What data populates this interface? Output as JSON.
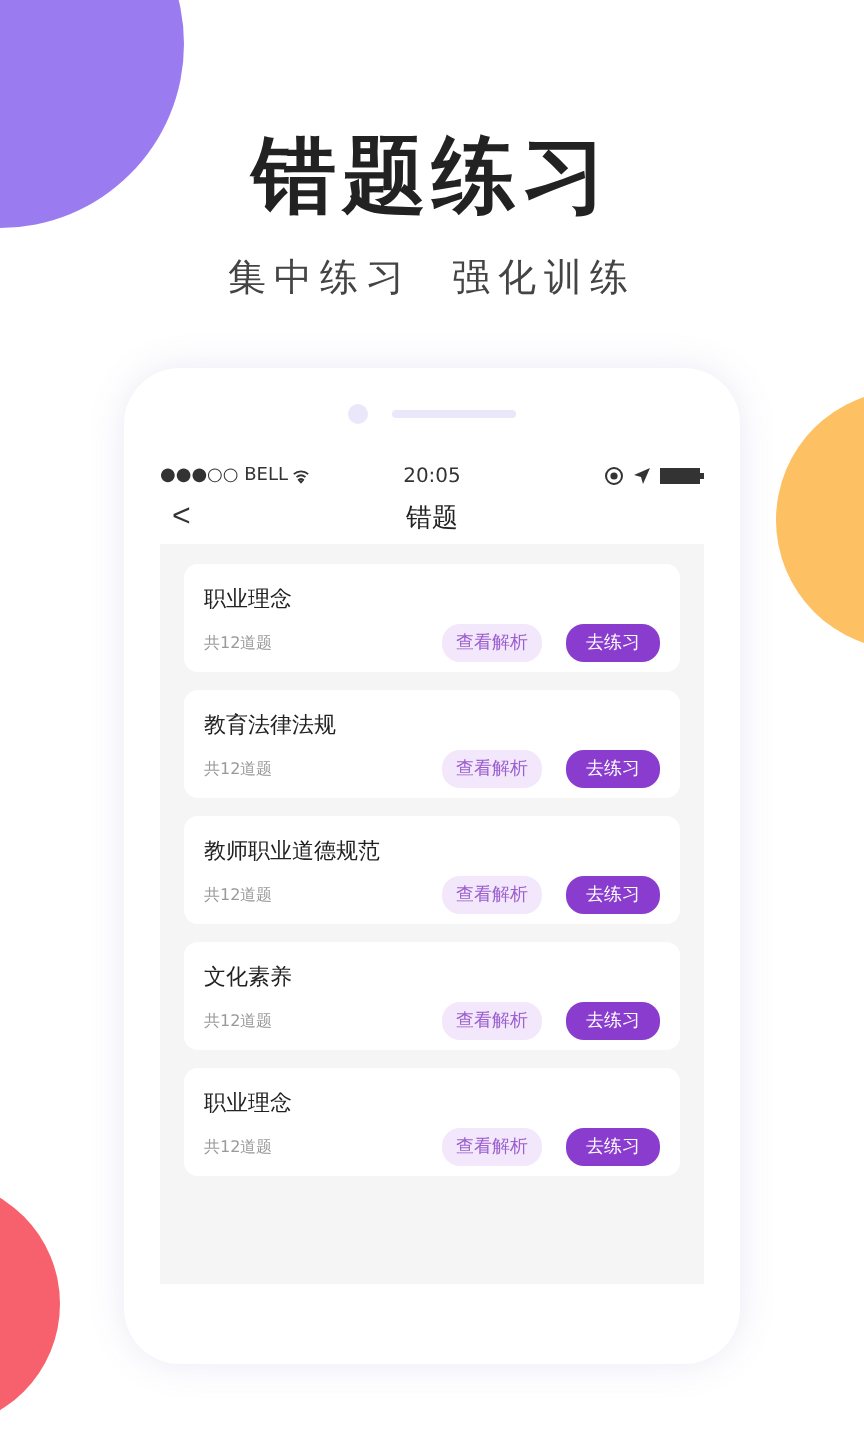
{
  "headline": "错题练习",
  "subtitle": "集中练习  强化训练",
  "status_bar": {
    "carrier": "●●●○○ BELL",
    "time": "20:05"
  },
  "nav": {
    "back": "<",
    "title": "错题"
  },
  "items": [
    {
      "title": "职业理念",
      "count": "共12道题",
      "review": "查看解析",
      "practice": "去练习"
    },
    {
      "title": "教育法律法规",
      "count": "共12道题",
      "review": "查看解析",
      "practice": "去练习"
    },
    {
      "title": "教师职业道德规范",
      "count": "共12道题",
      "review": "查看解析",
      "practice": "去练习"
    },
    {
      "title": "文化素养",
      "count": "共12道题",
      "review": "查看解析",
      "practice": "去练习"
    },
    {
      "title": "职业理念",
      "count": "共12道题",
      "review": "查看解析",
      "practice": "去练习"
    }
  ]
}
